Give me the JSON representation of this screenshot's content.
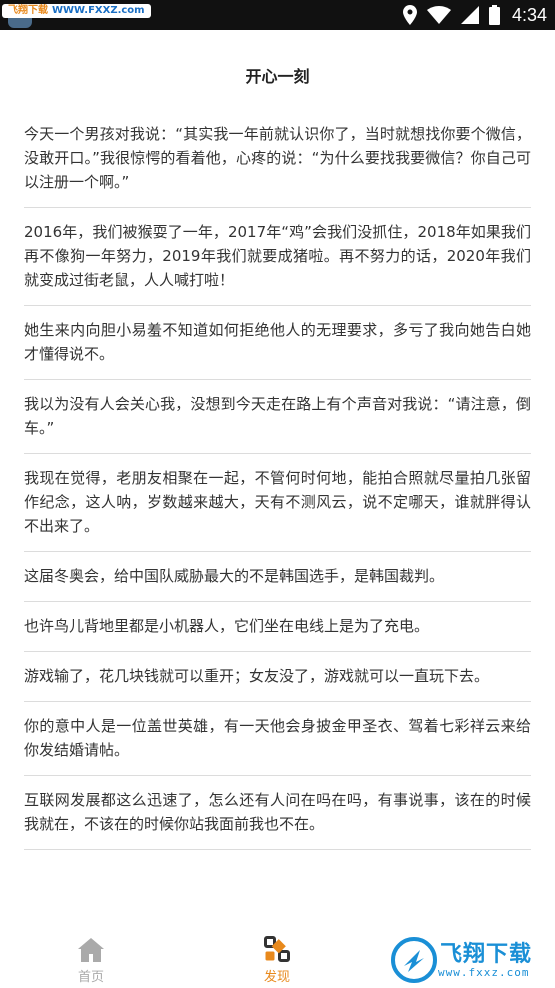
{
  "status_bar": {
    "watermark_site": "飞翔下载",
    "watermark_url": "WWW.FXXZ.com",
    "time": "4:34",
    "icons": [
      "location-icon",
      "wifi-icon",
      "signal-icon",
      "battery-icon"
    ]
  },
  "page": {
    "title": "开心一刻"
  },
  "jokes": [
    {
      "text": "今天一个男孩对我说：“其实我一年前就认识你了，当时就想找你要个微信，没敢开口。”我很惊愕的看着他，心疼的说：“为什么要找我要微信？你自己可以注册一个啊。”"
    },
    {
      "text": "2016年，我们被猴耍了一年，2017年“鸡”会我们没抓住，2018年如果我们再不像狗一年努力，2019年我们就要成猪啦。再不努力的话，2020年我们就变成过街老鼠，人人喊打啦！"
    },
    {
      "text": "她生来内向胆小易羞不知道如何拒绝他人的无理要求，多亏了我向她告白她才懂得说不。"
    },
    {
      "text": "我以为没有人会关心我，没想到今天走在路上有个声音对我说：“请注意，倒车。”"
    },
    {
      "text": "我现在觉得，老朋友相聚在一起，不管何时何地，能拍合照就尽量拍几张留作纪念，这人呐，岁数越来越大，天有不测风云，说不定哪天，谁就胖得认不出来了。"
    },
    {
      "text": "这届冬奥会，给中国队威胁最大的不是韩国选手，是韩国裁判。"
    },
    {
      "text": "也许鸟儿背地里都是小机器人，它们坐在电线上是为了充电。"
    },
    {
      "text": "游戏输了，花几块钱就可以重开；女友没了，游戏就可以一直玩下去。"
    },
    {
      "text": "你的意中人是一位盖世英雄，有一天他会身披金甲圣衣、驾着七彩祥云来给你发结婚请帖。"
    },
    {
      "text": "互联网发展都这么迅速了，怎么还有人问在吗在吗，有事说事，该在的时候我就在，不该在的时候你站我面前我也不在。"
    }
  ],
  "tab_bar": {
    "tabs": [
      {
        "label": "首页",
        "icon": "home-icon",
        "active": false
      },
      {
        "label": "发现",
        "icon": "discover-icon",
        "active": true
      }
    ]
  },
  "watermark": {
    "text": "飞翔下载",
    "url": "www.fxxz.com"
  },
  "colors": {
    "accent": "#e8891c",
    "inactive": "#aaaaaa",
    "divider": "#dcdcdc",
    "text": "#333333",
    "status_bar": "#111111"
  }
}
